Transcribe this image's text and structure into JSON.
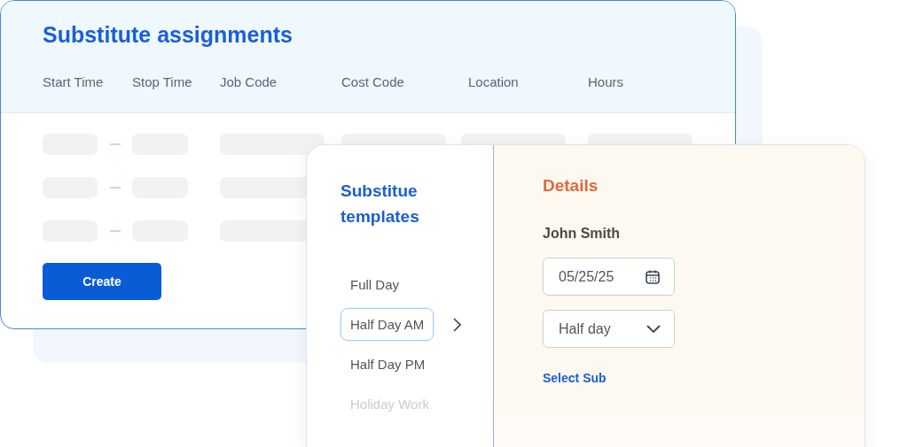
{
  "assignments": {
    "title": "Substitute assignments",
    "columns": [
      "Start Time",
      "Stop Time",
      "Job Code",
      "Cost Code",
      "Location",
      "Hours"
    ],
    "rows": [
      {
        "kind": "placeholder"
      },
      {
        "kind": "placeholder"
      },
      {
        "kind": "placeholder"
      }
    ],
    "create_button": "Create"
  },
  "templates": {
    "title": "Substitue templates",
    "items": [
      {
        "label": "Full Day",
        "selected": false,
        "disabled": false
      },
      {
        "label": "Half Day AM",
        "selected": true,
        "disabled": false
      },
      {
        "label": "Half Day PM",
        "selected": false,
        "disabled": false
      },
      {
        "label": "Holiday Work",
        "selected": false,
        "disabled": true
      }
    ]
  },
  "details": {
    "title": "Details",
    "name": "John Smith",
    "date_field": "05/25/25",
    "dropdown": "Half day",
    "link": "Select Sub"
  }
}
